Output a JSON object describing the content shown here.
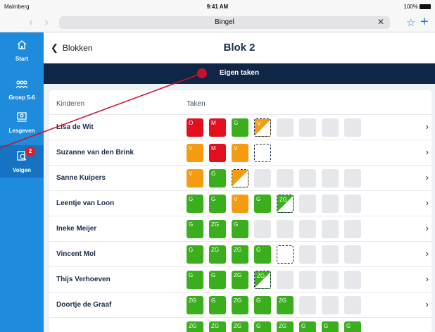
{
  "status_bar": {
    "carrier": "Malmberg",
    "time": "9:41 AM",
    "battery": "100%"
  },
  "browser": {
    "url": "Bingel",
    "clear_icon": "clear-x-icon",
    "back_icon": "chevron-left-icon",
    "forward_icon": "chevron-right-icon",
    "bookmark_icon": "star-icon",
    "new_tab_icon": "plus-icon"
  },
  "sidebar": {
    "items": [
      {
        "label": "Start",
        "icon": "home-icon"
      },
      {
        "label": "Groep 5-6",
        "icon": "group-icon"
      },
      {
        "label": "Lesgeven",
        "icon": "teach-icon"
      },
      {
        "label": "Volgen",
        "icon": "follow-icon",
        "badge": "2"
      }
    ]
  },
  "header": {
    "back_label": "Blokken",
    "title": "Blok 2"
  },
  "banner": {
    "label": "Eigen taken"
  },
  "table": {
    "col_children": "Kinderen",
    "col_tasks": "Taken",
    "rows": [
      {
        "name": "Lisa de Wit",
        "tasks": [
          {
            "s": "red",
            "c": "O"
          },
          {
            "s": "red",
            "c": "M"
          },
          {
            "s": "green",
            "c": "G"
          },
          {
            "s": "half-orange",
            "c": "V"
          },
          {
            "s": "empty",
            "c": ""
          },
          {
            "s": "empty",
            "c": ""
          },
          {
            "s": "empty",
            "c": ""
          },
          {
            "s": "empty",
            "c": ""
          }
        ]
      },
      {
        "name": "Suzanne van den Brink",
        "tasks": [
          {
            "s": "orange",
            "c": "V"
          },
          {
            "s": "red",
            "c": "M"
          },
          {
            "s": "orange",
            "c": "V"
          },
          {
            "s": "dashed",
            "c": ""
          }
        ]
      },
      {
        "name": "Sanne Kuipers",
        "tasks": [
          {
            "s": "orange",
            "c": "V"
          },
          {
            "s": "green",
            "c": "G"
          },
          {
            "s": "half-orange",
            "c": ""
          },
          {
            "s": "empty",
            "c": ""
          },
          {
            "s": "empty",
            "c": ""
          },
          {
            "s": "empty",
            "c": ""
          },
          {
            "s": "empty",
            "c": ""
          },
          {
            "s": "empty",
            "c": ""
          }
        ]
      },
      {
        "name": "Leentje van Loon",
        "tasks": [
          {
            "s": "green",
            "c": "G"
          },
          {
            "s": "green",
            "c": "G"
          },
          {
            "s": "orange",
            "c": "V"
          },
          {
            "s": "green",
            "c": "G"
          },
          {
            "s": "half-green",
            "c": "ZG"
          },
          {
            "s": "empty",
            "c": ""
          },
          {
            "s": "empty",
            "c": ""
          },
          {
            "s": "empty",
            "c": ""
          }
        ]
      },
      {
        "name": "Ineke Meijer",
        "tasks": [
          {
            "s": "green",
            "c": "G"
          },
          {
            "s": "green",
            "c": "ZG"
          },
          {
            "s": "green",
            "c": "G"
          },
          {
            "s": "empty",
            "c": ""
          },
          {
            "s": "empty",
            "c": ""
          },
          {
            "s": "empty",
            "c": ""
          },
          {
            "s": "empty",
            "c": ""
          },
          {
            "s": "empty",
            "c": ""
          }
        ]
      },
      {
        "name": "Vincent Mol",
        "tasks": [
          {
            "s": "green",
            "c": "G"
          },
          {
            "s": "green",
            "c": "ZG"
          },
          {
            "s": "green",
            "c": "ZG"
          },
          {
            "s": "green",
            "c": "G"
          },
          {
            "s": "dashed",
            "c": ""
          },
          {
            "s": "empty",
            "c": ""
          },
          {
            "s": "empty",
            "c": ""
          },
          {
            "s": "empty",
            "c": ""
          }
        ]
      },
      {
        "name": "Thijs Verhoeven",
        "tasks": [
          {
            "s": "green",
            "c": "G"
          },
          {
            "s": "green",
            "c": "G"
          },
          {
            "s": "green",
            "c": "ZG"
          },
          {
            "s": "half-green",
            "c": "ZG"
          },
          {
            "s": "empty",
            "c": ""
          },
          {
            "s": "empty",
            "c": ""
          },
          {
            "s": "empty",
            "c": ""
          },
          {
            "s": "empty",
            "c": ""
          }
        ]
      },
      {
        "name": "Doortje de Graaf",
        "tasks": [
          {
            "s": "green",
            "c": "ZG"
          },
          {
            "s": "green",
            "c": "G"
          },
          {
            "s": "green",
            "c": "ZG"
          },
          {
            "s": "green",
            "c": "G"
          },
          {
            "s": "green",
            "c": "ZG"
          },
          {
            "s": "empty",
            "c": ""
          },
          {
            "s": "empty",
            "c": ""
          },
          {
            "s": "empty",
            "c": ""
          }
        ]
      },
      {
        "name": "",
        "tasks": [
          {
            "s": "green",
            "c": "ZG"
          },
          {
            "s": "green",
            "c": "ZG"
          },
          {
            "s": "green",
            "c": "ZG"
          },
          {
            "s": "green",
            "c": "G"
          },
          {
            "s": "green",
            "c": "ZG"
          },
          {
            "s": "green",
            "c": "G"
          },
          {
            "s": "green",
            "c": "G"
          },
          {
            "s": "green",
            "c": "G"
          }
        ]
      }
    ]
  },
  "colors": {
    "sidebar": "#1f8bdc",
    "banner": "#0f2647",
    "green": "#3aae1d",
    "orange": "#f39c12",
    "red": "#e2101f",
    "annotation": "#c8102e"
  }
}
